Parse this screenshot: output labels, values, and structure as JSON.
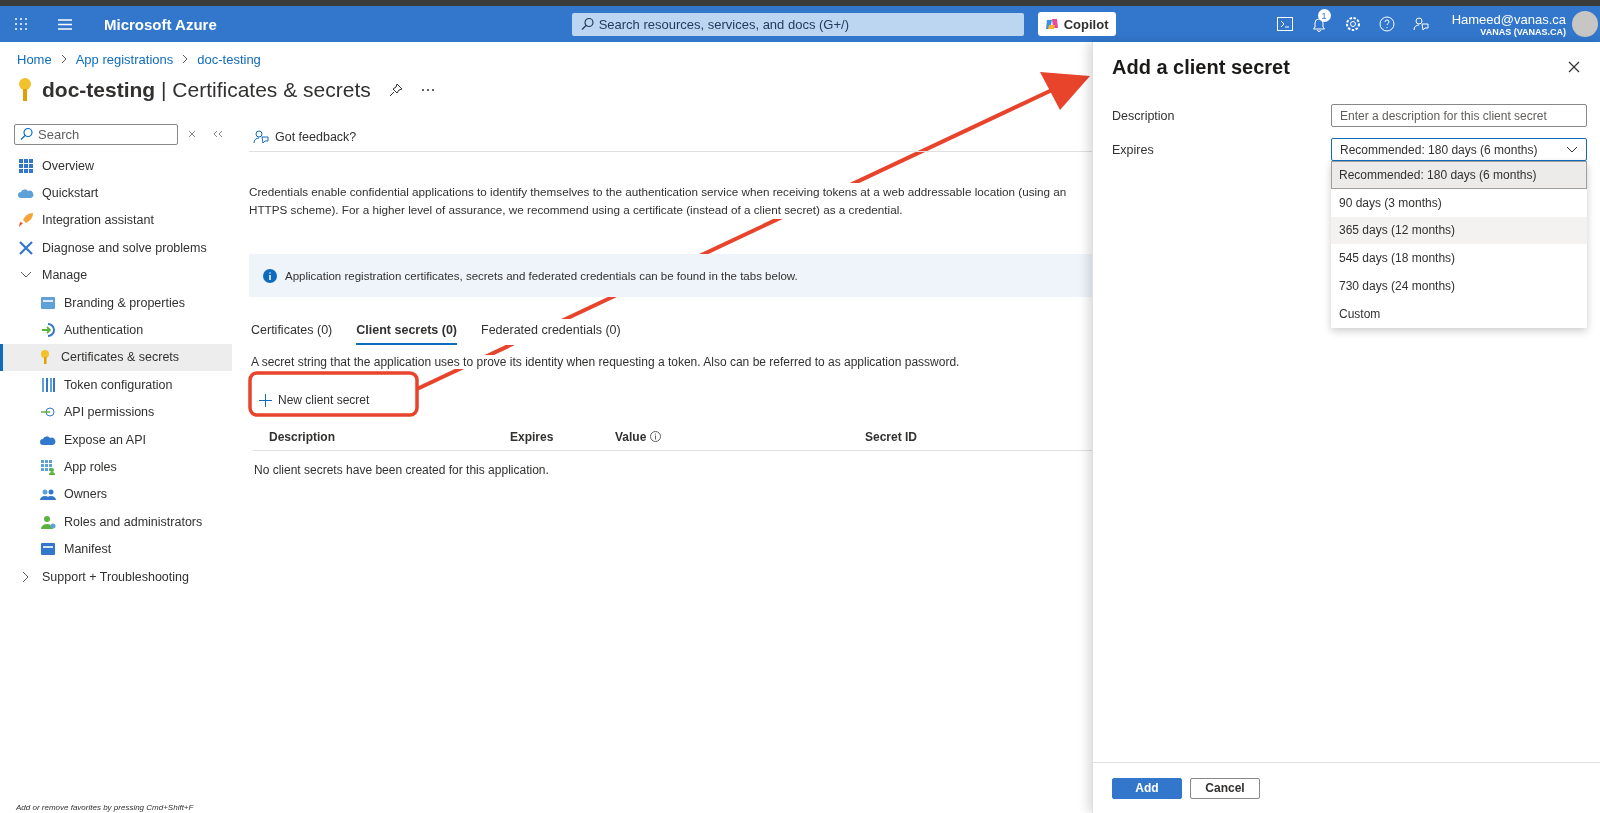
{
  "topbar": {
    "product": "Microsoft Azure",
    "search": {
      "placeholder": "Search resources, services, and docs (G+/)"
    },
    "copilot": "Copilot",
    "notification_count": "1",
    "user": {
      "email": "Hameed@vanas.ca",
      "tenant": "VANAS (VANAS.CA)"
    }
  },
  "breadcrumb": [
    "Home",
    "App registrations",
    "doc-testing"
  ],
  "page_title": {
    "resource": "doc-testing",
    "separator": "|",
    "section": "Certificates & secrets"
  },
  "sidebar": {
    "search": {
      "placeholder": "Search"
    },
    "items": [
      {
        "label": "Overview",
        "kind": "link",
        "selected": false
      },
      {
        "label": "Quickstart",
        "kind": "link",
        "selected": false
      },
      {
        "label": "Integration assistant",
        "kind": "link",
        "selected": false
      },
      {
        "label": "Diagnose and solve problems",
        "kind": "link",
        "selected": false
      },
      {
        "label": "Manage",
        "kind": "group",
        "expanded": true,
        "children": [
          {
            "label": "Branding & properties",
            "selected": false
          },
          {
            "label": "Authentication",
            "selected": false
          },
          {
            "label": "Certificates & secrets",
            "selected": true
          },
          {
            "label": "Token configuration",
            "selected": false
          },
          {
            "label": "API permissions",
            "selected": false
          },
          {
            "label": "Expose an API",
            "selected": false
          },
          {
            "label": "App roles",
            "selected": false
          },
          {
            "label": "Owners",
            "selected": false
          },
          {
            "label": "Roles and administrators",
            "selected": false
          },
          {
            "label": "Manifest",
            "selected": false
          }
        ]
      },
      {
        "label": "Support + Troubleshooting",
        "kind": "group",
        "expanded": false
      }
    ]
  },
  "feedback": "Got feedback?",
  "description": "Credentials enable confidential applications to identify themselves to the authentication service when receiving tokens at a web addressable location (using an HTTPS scheme). For a higher level of assurance, we recommend using a certificate (instead of a client secret) as a credential.",
  "info_banner": "Application registration certificates, secrets and federated credentials can be found in the tabs below.",
  "tabs": [
    {
      "label": "Certificates (0)",
      "selected": false
    },
    {
      "label": "Client secrets (0)",
      "selected": true
    },
    {
      "label": "Federated credentials (0)",
      "selected": false
    }
  ],
  "tab_description": "A secret string that the application uses to prove its identity when requesting a token. Also can be referred to as application password.",
  "new_button": "New client secret",
  "table": {
    "columns": [
      {
        "label": "Description"
      },
      {
        "label": "Expires"
      },
      {
        "label": "Value",
        "info": true
      },
      {
        "label": "Secret ID"
      }
    ],
    "empty_message": "No client secrets have been created for this application."
  },
  "footer_hint": "Add or remove favorites by pressing Cmd+Shift+F",
  "panel": {
    "title": "Add a client secret",
    "fields": [
      {
        "label": "Description",
        "kind": "text",
        "placeholder": "Enter a description for this client secret"
      },
      {
        "label": "Expires",
        "kind": "select",
        "value": "Recommended: 180 days (6 months)",
        "expanded": true,
        "options": [
          {
            "label": "Recommended: 180 days (6 months)",
            "selected": true,
            "hovered": false
          },
          {
            "label": "90 days (3 months)",
            "selected": false,
            "hovered": false
          },
          {
            "label": "365 days (12 months)",
            "selected": false,
            "hovered": true
          },
          {
            "label": "545 days (18 months)",
            "selected": false,
            "hovered": false
          },
          {
            "label": "730 days (24 months)",
            "selected": false,
            "hovered": false
          },
          {
            "label": "Custom",
            "selected": false,
            "hovered": false
          }
        ]
      }
    ],
    "buttons": [
      {
        "label": "Add",
        "primary": true
      },
      {
        "label": "Cancel",
        "primary": false
      }
    ]
  }
}
